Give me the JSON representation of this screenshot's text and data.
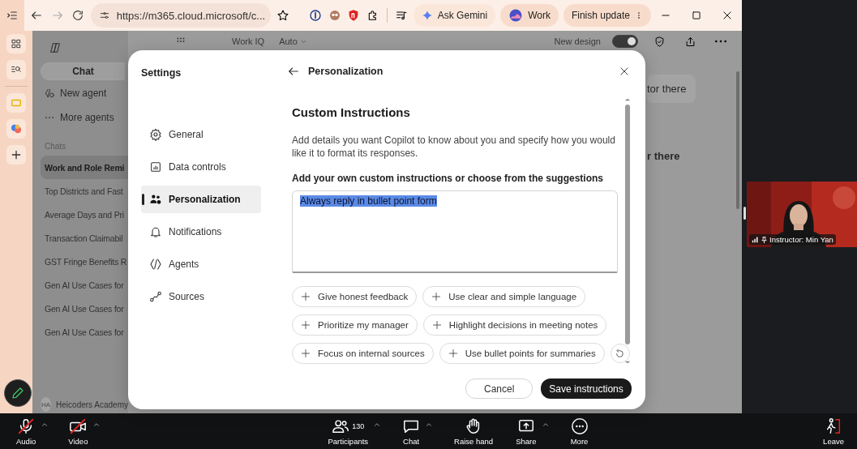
{
  "browser": {
    "nav": [
      {
        "kind": "back",
        "disabled": false
      },
      {
        "kind": "forward",
        "disabled": true
      },
      {
        "kind": "reload",
        "disabled": false
      }
    ],
    "url": "https://m365.cloud.microsoft/c...",
    "chips": [
      {
        "kind": "gemini",
        "label": "Ask Gemini"
      },
      {
        "kind": "profile",
        "label": "Work"
      },
      {
        "kind": "update",
        "label": "Finish update"
      }
    ]
  },
  "copilot": {
    "tabs": [
      {
        "label": "Chat",
        "selected": true
      }
    ],
    "agents": [
      {
        "kind": "new",
        "label": "New agent"
      },
      {
        "kind": "more",
        "label": "More agents"
      }
    ],
    "chats_heading": "Chats",
    "chats": [
      {
        "title": "Work and Role Remi",
        "selected": true
      },
      {
        "title": "Top Districts and Fast",
        "selected": false
      },
      {
        "title": "Average Days and Pri",
        "selected": false
      },
      {
        "title": "Transaction Claimabil",
        "selected": false
      },
      {
        "title": "GST Fringe Benefits R",
        "selected": false
      },
      {
        "title": "Gen AI Use Cases for",
        "selected": false
      },
      {
        "title": "Gen AI Use Cases for",
        "selected": false
      },
      {
        "title": "Gen AI Use Cases for",
        "selected": false
      }
    ],
    "account": {
      "initials": "HA",
      "name": "Heicoders Academy"
    },
    "topbar": {
      "items": [
        "Work IQ",
        "Auto"
      ],
      "new_design": {
        "label": "New design",
        "on": true
      }
    },
    "messages": [
      "tor there",
      "r there"
    ]
  },
  "settings": {
    "title": "Settings",
    "nav": [
      {
        "kind": "general",
        "label": "General",
        "selected": false
      },
      {
        "kind": "data",
        "label": "Data controls",
        "selected": false
      },
      {
        "kind": "personalization",
        "label": "Personalization",
        "selected": true
      },
      {
        "kind": "notifications",
        "label": "Notifications",
        "selected": false
      },
      {
        "kind": "agents",
        "label": "Agents",
        "selected": false
      },
      {
        "kind": "sources",
        "label": "Sources",
        "selected": false
      }
    ],
    "page_title": "Personalization",
    "heading": "Custom Instructions",
    "description": "Add details you want Copilot to know about you and specify how you would like it to format its responses.",
    "field_label": "Add your own custom instructions or choose from the suggestions",
    "instructions": {
      "value": "Always reply in bullet point form",
      "text_selected": true
    },
    "suggestions": [
      [
        "Give honest feedback",
        "Use clear and simple language"
      ],
      [
        "Prioritize my manager",
        "Highlight decisions in meeting notes"
      ],
      [
        "Focus on internal sources",
        "Use bullet points for summaries"
      ]
    ],
    "buttons": [
      {
        "kind": "secondary",
        "label": "Cancel"
      },
      {
        "kind": "primary",
        "label": "Save instructions"
      }
    ]
  },
  "video": {
    "name": "Instructor: Min Yan"
  },
  "meeting_toolbar": {
    "left": [
      {
        "kind": "audio",
        "label": "Audio",
        "muted": true,
        "has_menu": true
      },
      {
        "kind": "video",
        "label": "Video",
        "muted": true,
        "has_menu": true
      }
    ],
    "center": [
      {
        "kind": "participants",
        "label": "Participants",
        "count": "130",
        "has_menu": true
      },
      {
        "kind": "chat",
        "label": "Chat",
        "has_menu": true
      },
      {
        "kind": "hand",
        "label": "Raise hand",
        "has_menu": false
      },
      {
        "kind": "share",
        "label": "Share",
        "has_menu": true
      },
      {
        "kind": "more",
        "label": "More",
        "has_menu": false
      }
    ],
    "leave": "Leave"
  }
}
